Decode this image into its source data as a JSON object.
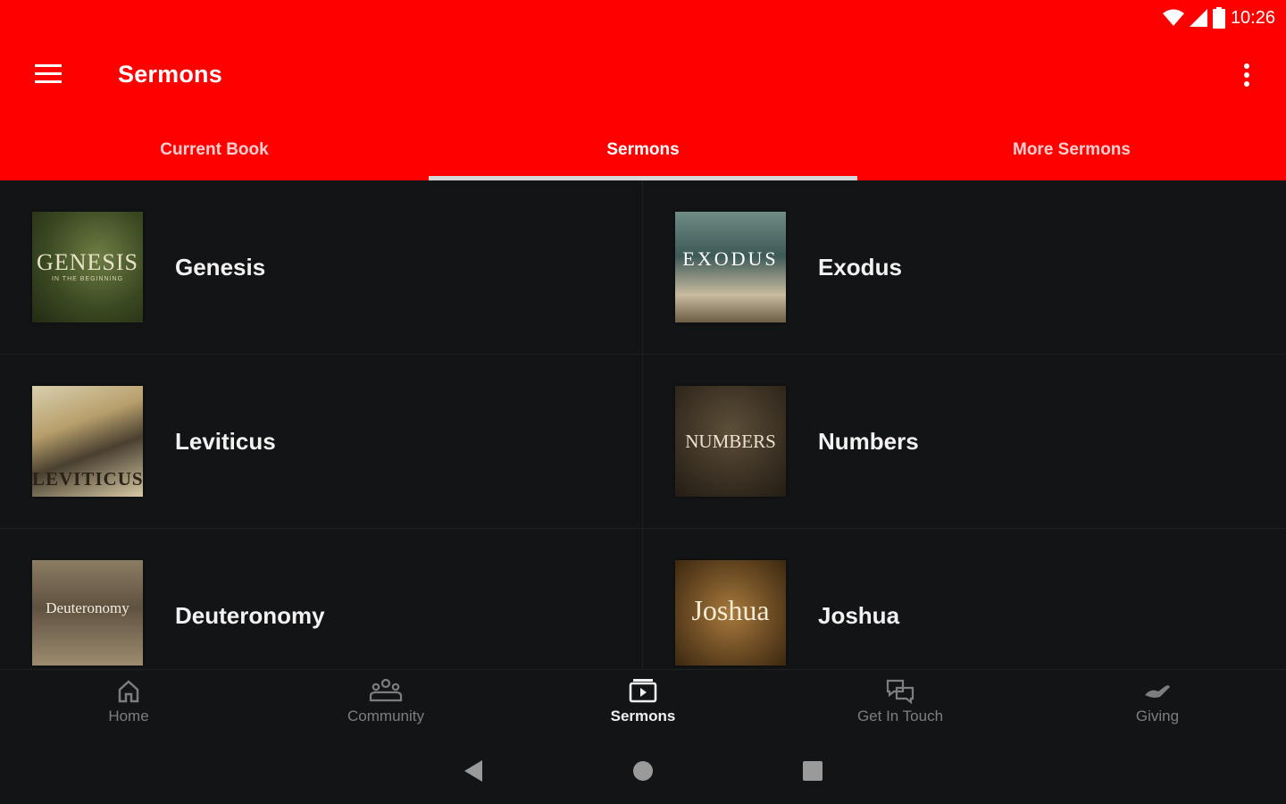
{
  "status_bar": {
    "time": "10:26"
  },
  "app_bar": {
    "title": "Sermons"
  },
  "tabs": [
    {
      "label": "Current Book",
      "active": false
    },
    {
      "label": "Sermons",
      "active": true
    },
    {
      "label": "More Sermons",
      "active": false
    }
  ],
  "books": [
    {
      "name": "Genesis",
      "thumb_title": "GENESIS",
      "thumb_sub": "IN THE BEGINNING"
    },
    {
      "name": "Exodus",
      "thumb_title": "EXODUS",
      "thumb_sub": ""
    },
    {
      "name": "Leviticus",
      "thumb_title": "LEVITICUS",
      "thumb_sub": ""
    },
    {
      "name": "Numbers",
      "thumb_title": "NUMBERS",
      "thumb_sub": ""
    },
    {
      "name": "Deuteronomy",
      "thumb_title": "Deuteronomy",
      "thumb_sub": ""
    },
    {
      "name": "Joshua",
      "thumb_title": "Joshua",
      "thumb_sub": ""
    }
  ],
  "bottom_nav": [
    {
      "label": "Home",
      "icon": "home-icon",
      "active": false
    },
    {
      "label": "Community",
      "icon": "community-icon",
      "active": false
    },
    {
      "label": "Sermons",
      "icon": "sermons-icon",
      "active": true
    },
    {
      "label": "Get In Touch",
      "icon": "chat-icon",
      "active": false
    },
    {
      "label": "Giving",
      "icon": "giving-icon",
      "active": false
    }
  ],
  "colors": {
    "accent": "#ff0000",
    "background": "#131416"
  }
}
